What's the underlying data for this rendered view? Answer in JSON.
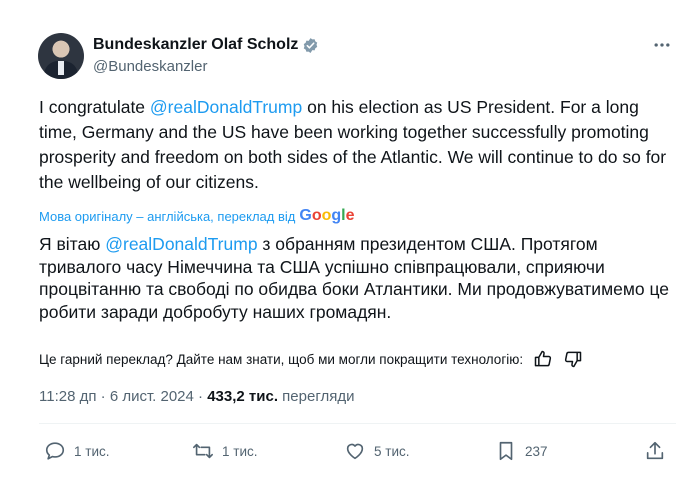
{
  "author": {
    "name": "Bundeskanzler Olaf Scholz",
    "handle": "@Bundeskanzler"
  },
  "more_icon": "more-horizontal-icon",
  "tweet": {
    "text_before": "I congratulate ",
    "mention": "@realDonaldTrump",
    "text_after": " on his election as US President. For a long time, Germany and the US have been working together successfully promoting prosperity and freedom on both sides of the Atlantic. We will continue to do so for the wellbeing of our citizens."
  },
  "translation": {
    "source_note": "Мова оригіналу – англійська, переклад від",
    "provider": "Google",
    "text_before": "Я вітаю ",
    "mention": "@realDonaldTrump",
    "text_after": " з обранням президентом США. Протягом тривалого часу Німеччина та США успішно співпрацювали, сприяючи процвітанню та свободі по обидва боки Атлантики. Ми продовжуватимемо це робити заради добробуту наших громадян.",
    "feedback_prompt": "Це гарний переклад? Дайте нам знати, щоб ми могли покращити технологію:"
  },
  "meta": {
    "time": "11:28 дп",
    "separator": "·",
    "date": "6 лист. 2024",
    "views_count": "433,2 тис.",
    "views_label": "перегляди"
  },
  "actions": {
    "replies": "1 тис.",
    "reposts": "1 тис.",
    "likes": "5 тис.",
    "bookmarks": "237"
  },
  "colors": {
    "link": "#1d9bf0",
    "secondary_text": "#536471",
    "primary_text": "#0f1419"
  }
}
